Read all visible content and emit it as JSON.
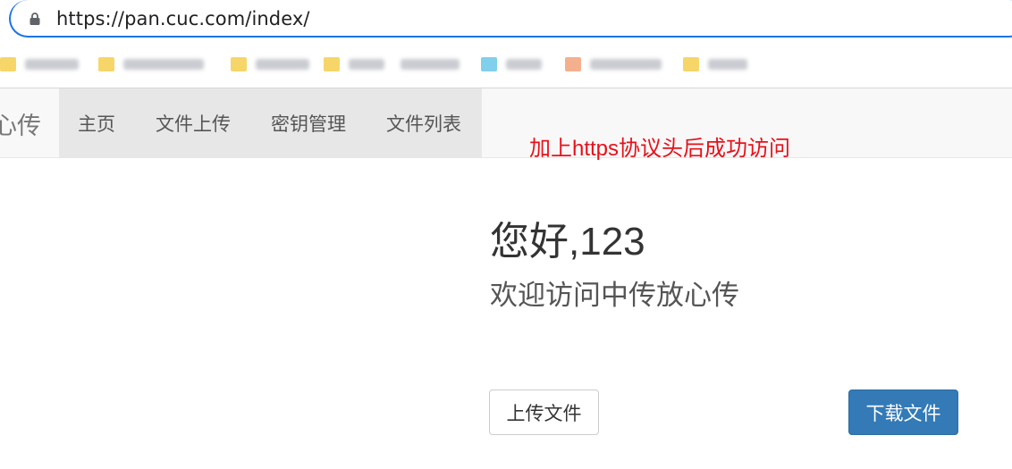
{
  "browser": {
    "url": "https://pan.cuc.com/index/"
  },
  "navbar": {
    "brand": "心传",
    "items": [
      "主页",
      "文件上传",
      "密钥管理",
      "文件列表"
    ]
  },
  "annotation": {
    "text": "加上https协议头后成功访问",
    "color": "#e8101a"
  },
  "main": {
    "greeting": "您好,123",
    "welcome": "欢迎访问中传放心传",
    "upload_button": "上传文件",
    "download_button": "下载文件"
  },
  "colors": {
    "accent": "#1a73e8",
    "primary_button": "#337ab7"
  }
}
